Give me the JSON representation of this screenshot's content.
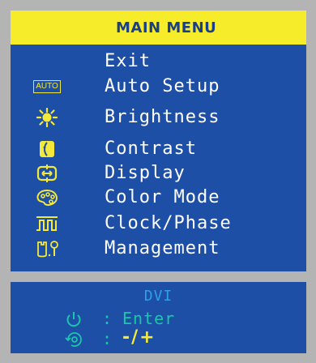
{
  "menu": {
    "title": "MAIN MENU",
    "items": [
      {
        "label": "Exit",
        "icon": "none"
      },
      {
        "label": "Auto Setup",
        "icon": "auto-icon",
        "icon_text": "AUTO"
      },
      {
        "label": "Brightness",
        "icon": "sun-icon"
      },
      {
        "label": "Contrast",
        "icon": "contrast-icon"
      },
      {
        "label": "Display",
        "icon": "display-icon"
      },
      {
        "label": "Color Mode",
        "icon": "palette-icon"
      },
      {
        "label": "Clock/Phase",
        "icon": "clock-phase-icon"
      },
      {
        "label": "Management",
        "icon": "tools-icon"
      }
    ]
  },
  "info": {
    "input_source": "DVI",
    "enter_colon": ":",
    "enter_label": "Enter",
    "adjust_colon": ":",
    "adjust_keys": "-/+"
  },
  "colors": {
    "panel": "#1d4fa6",
    "title_bar": "#f6ec2a",
    "text": "#ffffff",
    "icon_yellow": "#f4e93a",
    "hint_green": "#18c8a8",
    "dvi_blue": "#2f9fe8"
  }
}
